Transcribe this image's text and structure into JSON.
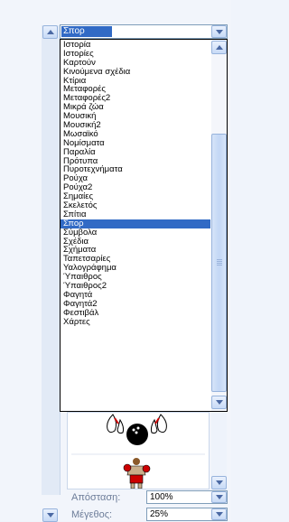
{
  "dropdown": {
    "value": "Σπορ"
  },
  "items": [
    "Ιστορία",
    "Ιστορίες",
    "Καρτούν",
    "Κινούμενα σχέδια",
    "Κτίρια",
    "Μεταφορές",
    "Μεταφορές2",
    "Μικρά ζώα",
    "Μουσική",
    "Μουσική2",
    "Μωσαϊκό",
    "Νομίσματα",
    "Παραλία",
    "Πρότυπα",
    "Πυροτεχνήματα",
    "Ρούχα",
    "Ρούχα2",
    "Σημαίες",
    "Σκελετός",
    "Σπίτια",
    "Σπορ",
    "Σύμβολα",
    "Σχέδια",
    "Σχήματα",
    "Ταπετσαρίες",
    "Υαλογράφημα",
    "Ύπαιθρος",
    "Ύπαιθρος2",
    "Φαγητά",
    "Φαγητά2",
    "Φεστιβάλ",
    "Χάρτες"
  ],
  "selected_index": 20,
  "distance": {
    "label": "Απόσταση:",
    "value": "100%"
  },
  "size": {
    "label": "Μέγεθος:",
    "value": "25%"
  },
  "icons": [
    "chevron-up-icon",
    "chevron-down-icon",
    "bowling-clipart",
    "boxer-clipart"
  ]
}
